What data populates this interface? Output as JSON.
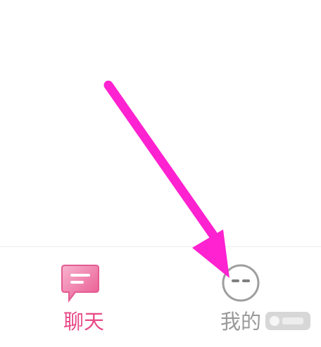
{
  "tab_bar": {
    "tabs": [
      {
        "label": "聊天",
        "icon": "chat-bubble-icon",
        "active": true
      },
      {
        "label": "我的",
        "icon": "face-icon",
        "active": false
      }
    ]
  },
  "annotation": {
    "icon": "arrow-icon",
    "color": "#ff22d0"
  },
  "colors": {
    "active_tab": "#e84a87",
    "inactive_tab": "#999999",
    "chat_icon_fill": "#f7a7c3",
    "chat_icon_stroke": "#e84a87"
  }
}
